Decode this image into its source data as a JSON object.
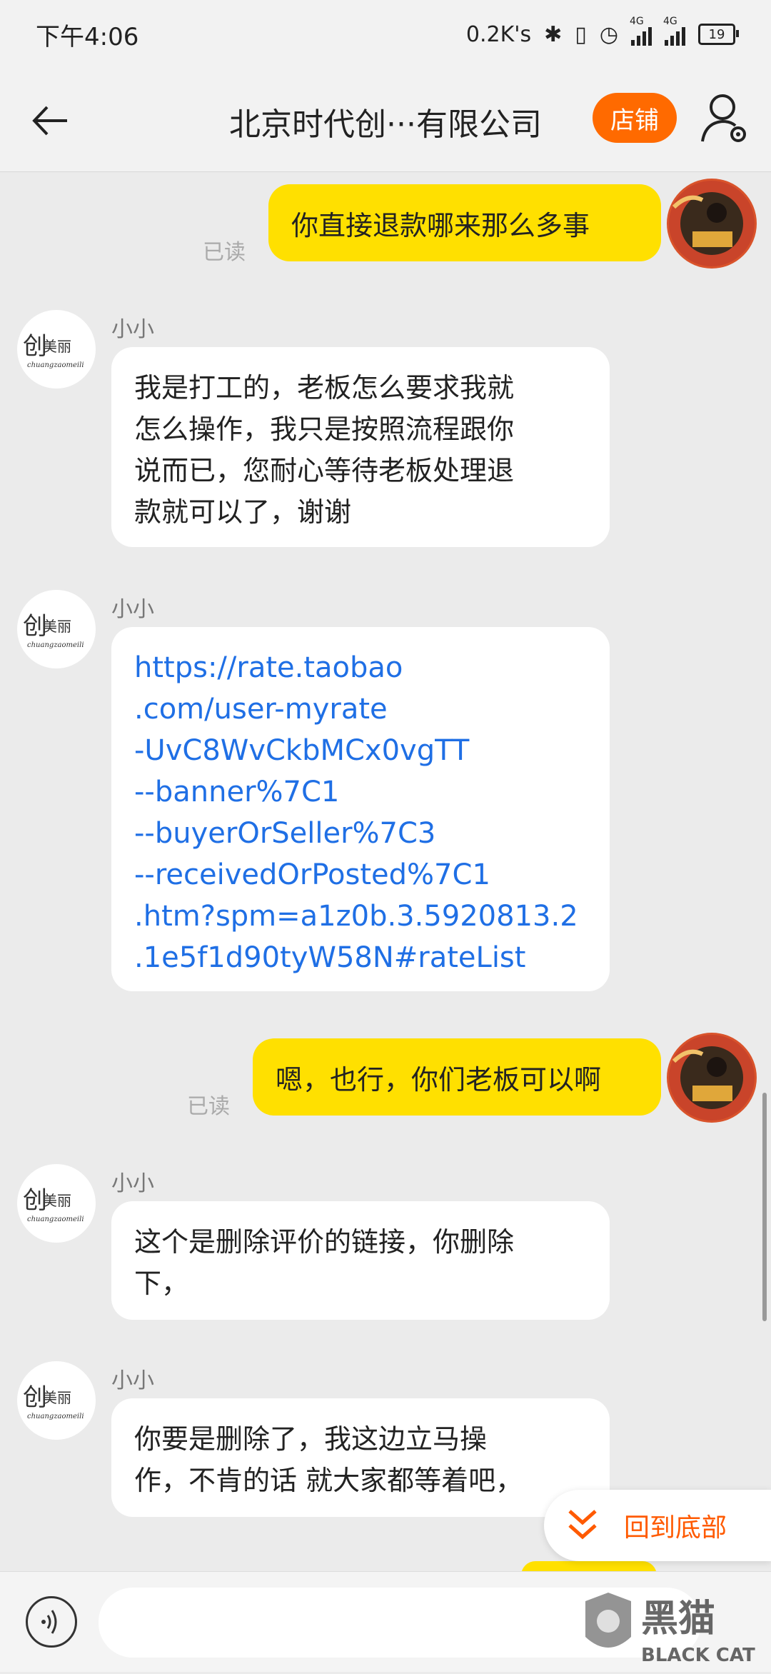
{
  "status_bar": {
    "time": "下午4:06",
    "speed": "0.2K's",
    "network1": "4G",
    "network2": "4G",
    "battery": "19"
  },
  "header": {
    "title": "北京时代创···有限公司",
    "shop_button": "店铺"
  },
  "messages": [
    {
      "direction": "out",
      "text": "你直接退款哪来那么多事",
      "read_label": "已读"
    },
    {
      "direction": "in",
      "sender": "小小",
      "lines": [
        "我是打工的，老板怎么要求我就",
        "怎么操作，我只是按照流程跟你",
        "说而已，您耐心等待老板处理退",
        "款就可以了，谢谢"
      ]
    },
    {
      "direction": "in",
      "sender": "小小",
      "link_lines": [
        "https://rate.taobao",
        ".com/user-myrate",
        "-UvC8WvCkbMCx0vgTT",
        "--banner%7C1",
        "--buyerOrSeller%7C3",
        "--receivedOrPosted%7C1",
        ".htm?spm=a1z0b.3.5920813.2",
        ".1e5f1d90tyW58N#rateList"
      ]
    },
    {
      "direction": "out",
      "text": "嗯，也行，你们老板可以啊",
      "read_label": "已读"
    },
    {
      "direction": "in",
      "sender": "小小",
      "lines": [
        "这个是删除评价的链接，你删除",
        "下，"
      ]
    },
    {
      "direction": "in",
      "sender": "小小",
      "lines": [
        "你要是删除了，我这边立马操",
        "作，不肯的话 就大家都等着吧，"
      ]
    }
  ],
  "scroll_bottom": {
    "label": "回到底部"
  },
  "input": {
    "placeholder": ""
  },
  "watermark": {
    "text_cn": "黑猫",
    "text_en": "BLACK CAT"
  },
  "colors": {
    "accent": "#ff6a00",
    "bubble_out": "#ffe000",
    "link": "#1f6fe5"
  }
}
